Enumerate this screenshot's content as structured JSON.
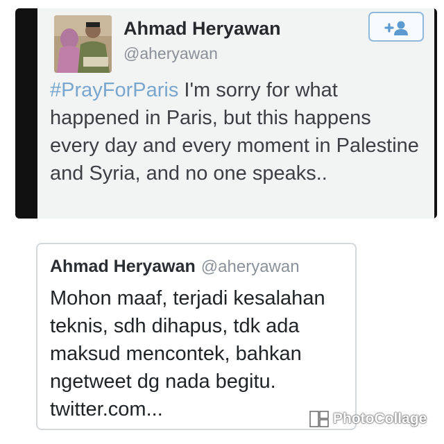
{
  "top_tweet": {
    "display_name": "Ahmad Heryawan",
    "handle": "@aheryawan",
    "hashtag": "#PrayForParis",
    "body": " I'm sorry for what happened in Paris, but this happens every day and every moment in Palestine and Syria, and no one speaks..",
    "follow_icon": "add-user-icon"
  },
  "bottom_tweet": {
    "display_name": "Ahmad Heryawan",
    "handle": "@aheryawan",
    "body": "Mohon maaf, terjadi kesalahan teknis, sdh dihapus, tdk ada maksud mencontek, bahkan ngetweet dg nada begitu. twitter.com..."
  },
  "watermark": {
    "text": "PhotoCollage"
  },
  "colors": {
    "hashtag": "#78a6cf",
    "follow_border": "#8fb8de",
    "tweet_bg": "#f2f3f3",
    "frame_bg": "#111111"
  }
}
